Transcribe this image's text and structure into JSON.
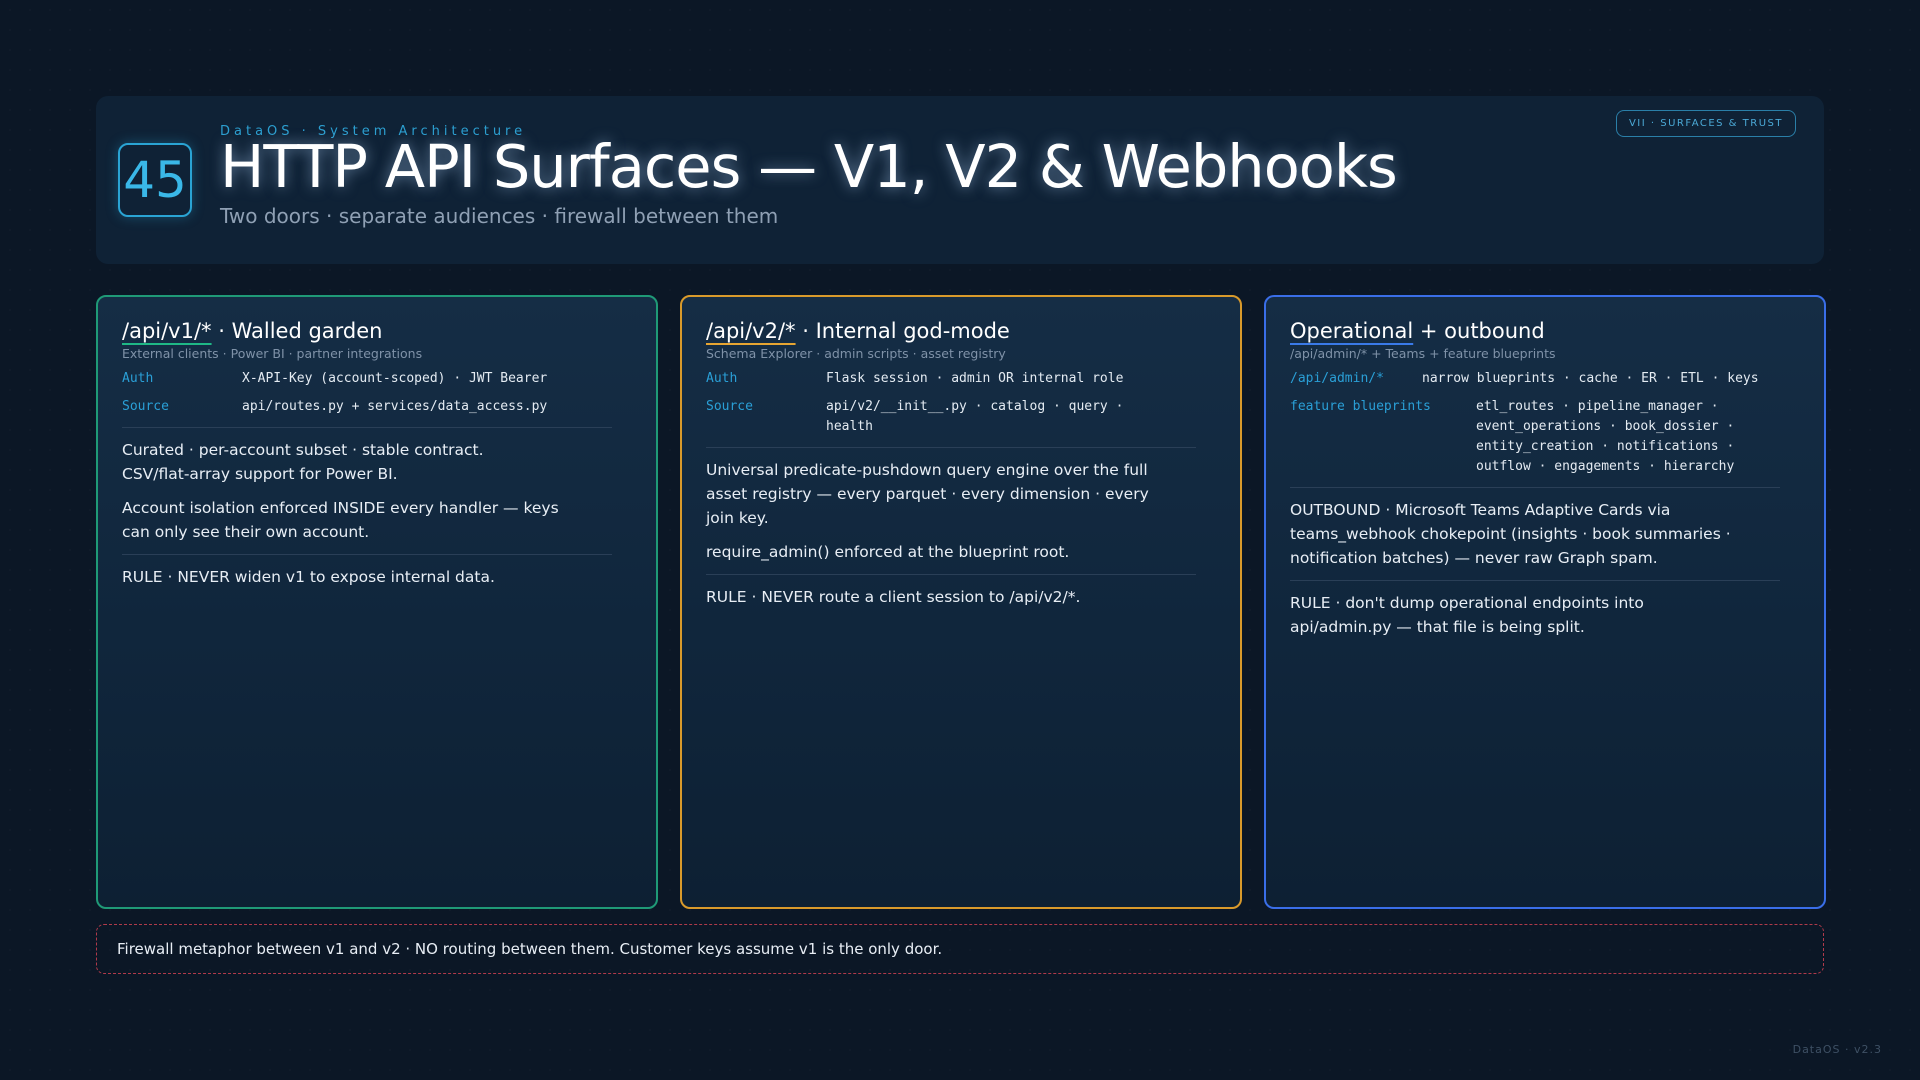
{
  "header": {
    "number": "45",
    "eyebrow": "DataOS · System Architecture",
    "title": "HTTP API Surfaces — V1, V2 & Webhooks",
    "subtitle": "Two doors · separate audiences · firewall between them",
    "section_tag": "VII · SURFACES & TRUST"
  },
  "panels": [
    {
      "title_path": "/api/v1/*",
      "title_rest": " · Walled garden",
      "subtitle": "External clients · Power BI · partner integrations",
      "rows": [
        {
          "key": "Auth",
          "lines": [
            "X-API-Key (account-scoped) · JWT Bearer"
          ]
        },
        {
          "key": "Source",
          "lines": [
            "api/routes.py + services/data_access.py"
          ]
        }
      ],
      "paragraphs": [
        [
          "Curated · per-account subset · stable contract.",
          "CSV/flat-array support for Power BI."
        ],
        [
          "Account isolation enforced INSIDE every handler — keys",
          "can only see their own account."
        ]
      ],
      "rule": "RULE · NEVER widen v1 to expose internal data."
    },
    {
      "title_path": "/api/v2/*",
      "title_rest": " · Internal god-mode",
      "subtitle": "Schema Explorer · admin scripts · asset registry",
      "rows": [
        {
          "key": "Auth",
          "lines": [
            "Flask session · admin OR internal role"
          ]
        },
        {
          "key": "Source",
          "lines": [
            "api/v2/__init__.py · catalog · query ·",
            "health"
          ]
        }
      ],
      "paragraphs": [
        [
          "Universal predicate-pushdown query engine over the full",
          "asset registry — every parquet · every dimension · every",
          "join key."
        ],
        [
          "require_admin() enforced at the blueprint root."
        ]
      ],
      "rule": "RULE · NEVER route a client session to /api/v2/*."
    },
    {
      "title_path": "Operational",
      "title_rest": " + outbound",
      "subtitle": "/api/admin/* + Teams + feature blueprints",
      "rows": [
        {
          "key": "/api/admin/*",
          "lines": [
            "narrow blueprints · cache · ER · ETL · keys"
          ]
        },
        {
          "key": "feature blueprints",
          "lines": [
            "etl_routes · pipeline_manager ·",
            "event_operations · book_dossier ·",
            "entity_creation · notifications ·",
            "outflow · engagements · hierarchy"
          ]
        }
      ],
      "paragraphs": [
        [
          "OUTBOUND · Microsoft Teams Adaptive Cards via",
          "teams_webhook chokepoint (insights · book summaries ·",
          "notification batches) — never raw Graph spam."
        ]
      ],
      "rule_lines": [
        "RULE · don't dump operational endpoints into",
        "api/admin.py — that file is being split."
      ]
    }
  ],
  "footer": {
    "note": "Firewall metaphor between v1 and v2 · NO routing between them. Customer keys assume v1 is the only door.",
    "version": "DataOS · v2.3"
  },
  "colors": {
    "v1_accent": "#1f9a77",
    "v2_accent": "#d99a2b",
    "ops_accent": "#3a6ee8",
    "firewall": "#b03a4a"
  }
}
